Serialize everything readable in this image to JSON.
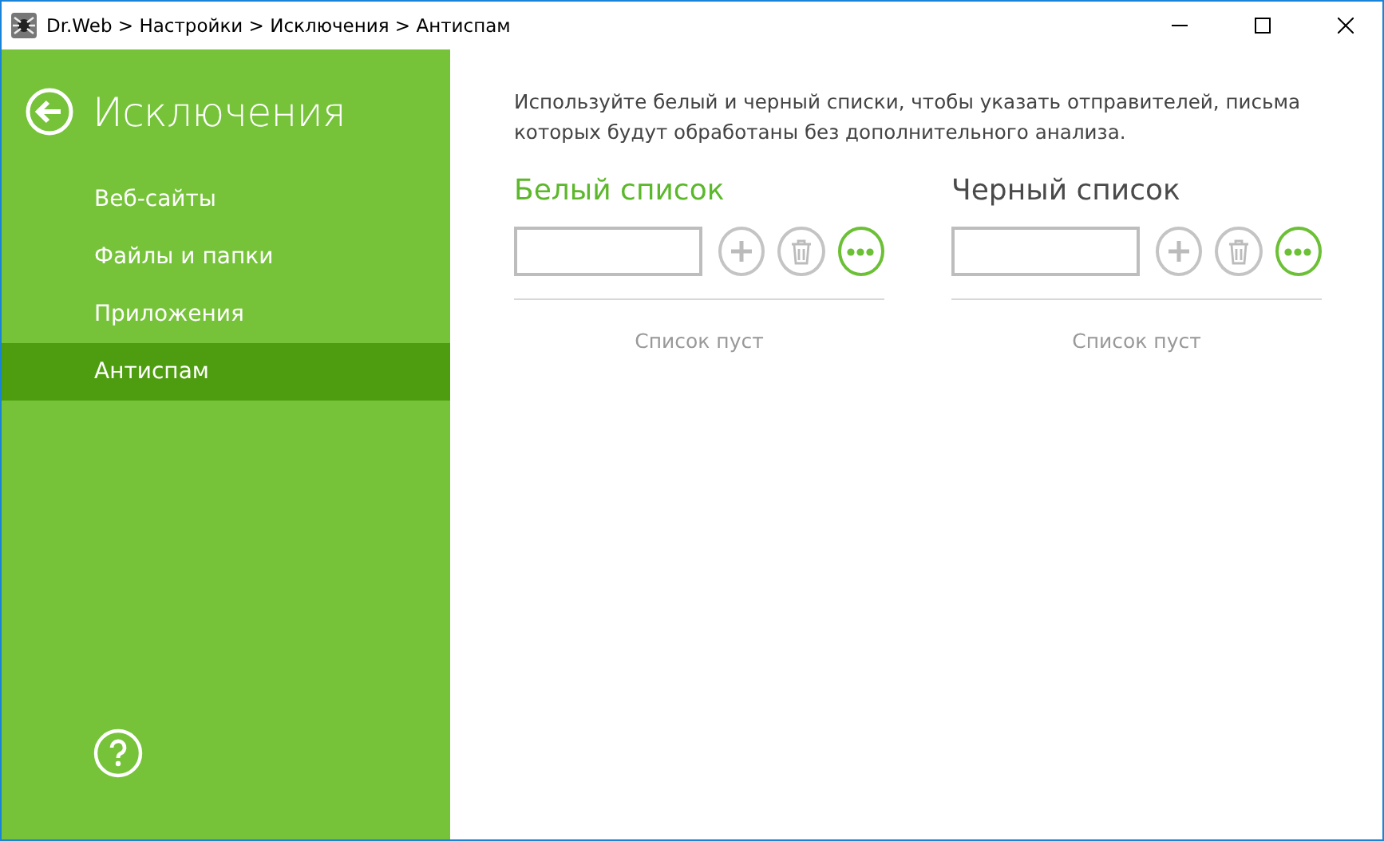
{
  "window": {
    "title": "Dr.Web > Настройки > Исключения > Антиспам"
  },
  "sidebar": {
    "title": "Исключения",
    "items": [
      {
        "label": "Веб-сайты",
        "selected": false
      },
      {
        "label": "Файлы и папки",
        "selected": false
      },
      {
        "label": "Приложения",
        "selected": false
      },
      {
        "label": "Антиспам",
        "selected": true
      }
    ]
  },
  "description": "Используйте белый и черный списки, чтобы указать отправителей, письма которых будут обработаны без дополнительного анализа.",
  "lists": [
    {
      "title": "Белый список",
      "active": true,
      "empty_text": "Список пуст"
    },
    {
      "title": "Черный список",
      "active": false,
      "empty_text": "Список пуст"
    }
  ]
}
